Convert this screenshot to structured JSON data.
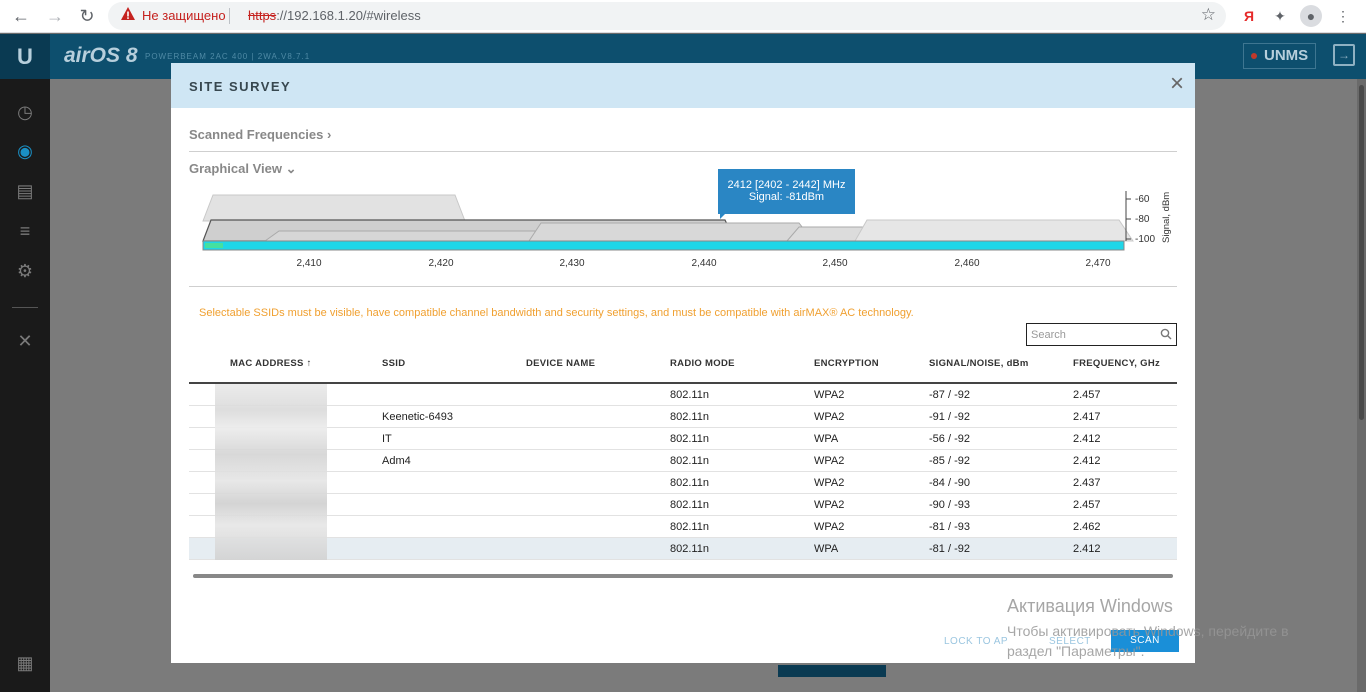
{
  "browser": {
    "insecure_label": "Не защищено",
    "url_scheme": "https",
    "url_rest": "://192.168.1.20/#wireless",
    "ext_ya": "Я"
  },
  "app": {
    "logo_u": "U",
    "os_name": "airOS 8",
    "model": "POWERBEAM 2AC 400 | 2WA.V8.7.1",
    "unms_label": "UNMS"
  },
  "modal": {
    "title": "SITE SURVEY",
    "scanned_frequencies": "Scanned Frequencies",
    "graphical_view": "Graphical View",
    "tooltip_line1": "2412 [2402 - 2442] MHz",
    "tooltip_line2": "Signal: -81dBm",
    "notice": "Selectable SSIDs must be visible, have compatible channel bandwidth and security settings, and must be compatible with airMAX® AC technology.",
    "search_placeholder": "Search",
    "buttons": {
      "lock": "LOCK TO AP",
      "select": "SELECT",
      "scan": "SCAN"
    }
  },
  "chart_data": {
    "type": "area",
    "x_ticks": [
      "2,410",
      "2,420",
      "2,430",
      "2,440",
      "2,450",
      "2,460",
      "2,470"
    ],
    "y_ticks": [
      "-60",
      "-80",
      "-100"
    ],
    "ylabel": "Signal, dBm",
    "series": [
      {
        "freq_mhz": 2412,
        "range": [
          2402,
          2442
        ],
        "signal_dbm": -56
      },
      {
        "freq_mhz": 2412,
        "range": [
          2402,
          2442
        ],
        "signal_dbm": -81
      },
      {
        "freq_mhz": 2412,
        "range": [
          2402,
          2442
        ],
        "signal_dbm": -85
      },
      {
        "freq_mhz": 2417,
        "range": [
          2407,
          2427
        ],
        "signal_dbm": -91
      },
      {
        "freq_mhz": 2437,
        "range": [
          2427,
          2447
        ],
        "signal_dbm": -84
      },
      {
        "freq_mhz": 2457,
        "range": [
          2447,
          2467
        ],
        "signal_dbm": -87
      },
      {
        "freq_mhz": 2457,
        "range": [
          2447,
          2467
        ],
        "signal_dbm": -90
      },
      {
        "freq_mhz": 2462,
        "range": [
          2452,
          2472
        ],
        "signal_dbm": -81
      }
    ]
  },
  "table": {
    "headers": {
      "mac": "MAC ADDRESS",
      "ssid": "SSID",
      "device": "DEVICE NAME",
      "radio": "RADIO MODE",
      "enc": "ENCRYPTION",
      "signal": "SIGNAL/NOISE, dBm",
      "freq": "FREQUENCY, GHz"
    },
    "sort_arrow": "↑",
    "rows": [
      {
        "ssid": "",
        "device": "",
        "radio": "802.11n",
        "enc": "WPA2",
        "signal": "-87 / -92",
        "freq": "2.457"
      },
      {
        "ssid": "Keenetic-6493",
        "device": "",
        "radio": "802.11n",
        "enc": "WPA2",
        "signal": "-91 / -92",
        "freq": "2.417"
      },
      {
        "ssid": "IT",
        "device": "",
        "radio": "802.11n",
        "enc": "WPA",
        "signal": "-56 / -92",
        "freq": "2.412"
      },
      {
        "ssid": "Adm4",
        "device": "",
        "radio": "802.11n",
        "enc": "WPA2",
        "signal": "-85 / -92",
        "freq": "2.412"
      },
      {
        "ssid": "",
        "device": "",
        "radio": "802.11n",
        "enc": "WPA2",
        "signal": "-84 / -90",
        "freq": "2.437"
      },
      {
        "ssid": "",
        "device": "",
        "radio": "802.11n",
        "enc": "WPA2",
        "signal": "-90 / -93",
        "freq": "2.457"
      },
      {
        "ssid": "",
        "device": "",
        "radio": "802.11n",
        "enc": "WPA2",
        "signal": "-81 / -93",
        "freq": "2.462"
      },
      {
        "ssid": "",
        "device": "",
        "radio": "802.11n",
        "enc": "WPA",
        "signal": "-81 / -92",
        "freq": "2.412"
      }
    ]
  },
  "watermark": {
    "title": "Активация Windows",
    "text": "Чтобы активировать Windows, перейдите в раздел \"Параметры\"."
  }
}
